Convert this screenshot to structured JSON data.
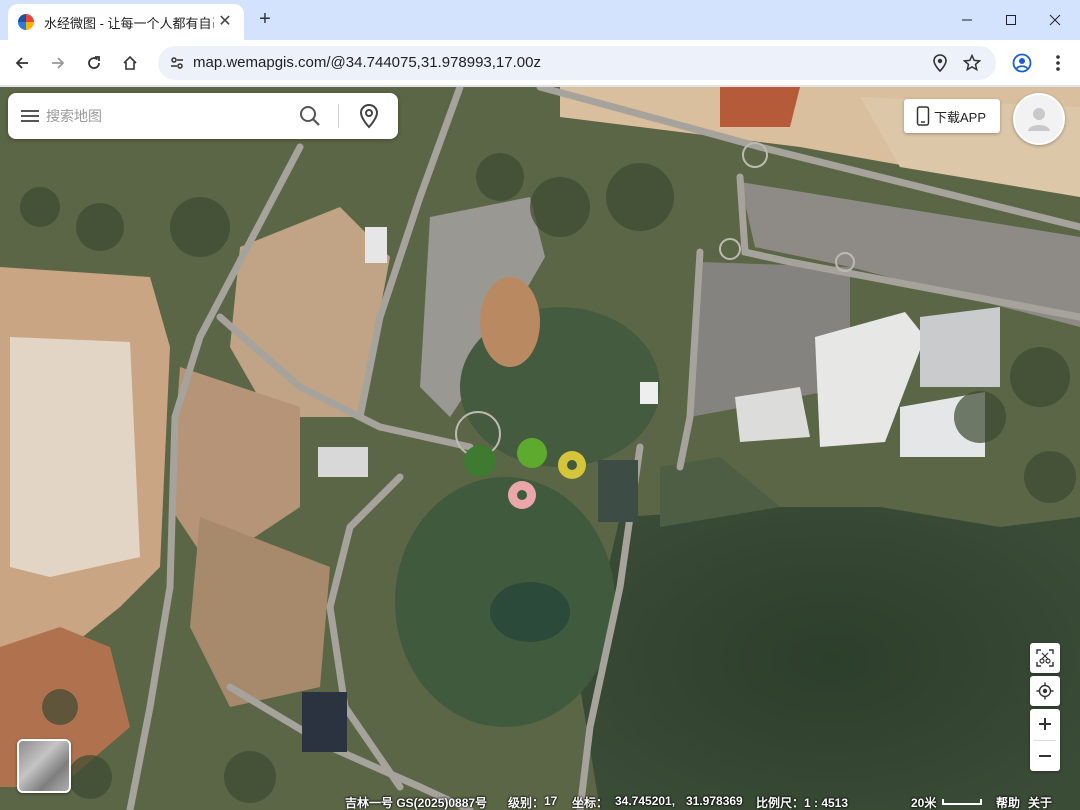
{
  "browser": {
    "tab_title": "水经微图 - 让每一个人都有自己",
    "url": "map.wemapgis.com/@34.744075,31.978993,17.00z"
  },
  "search": {
    "placeholder": "搜索地图"
  },
  "header": {
    "download_label": "下载APP"
  },
  "status": {
    "source": "吉林一号 GS(2025)0887号",
    "level_label": "级别：",
    "level_value": "17",
    "coord_label": "坐标：",
    "lon": "34.745201,",
    "lat": "31.978369",
    "scale_label": "比例尺：1 : 4513",
    "scale_bar_label": "20米",
    "help": "帮助",
    "about": "关于"
  },
  "icons": {
    "favicon": "wemap-logo-icon",
    "menu": "hamburger-menu-icon",
    "search": "search-icon",
    "location_pin": "location-pin-icon",
    "phone": "phone-icon",
    "avatar": "user-avatar-icon",
    "screenshot": "screenshot-tool-icon",
    "locate": "locate-me-icon"
  }
}
